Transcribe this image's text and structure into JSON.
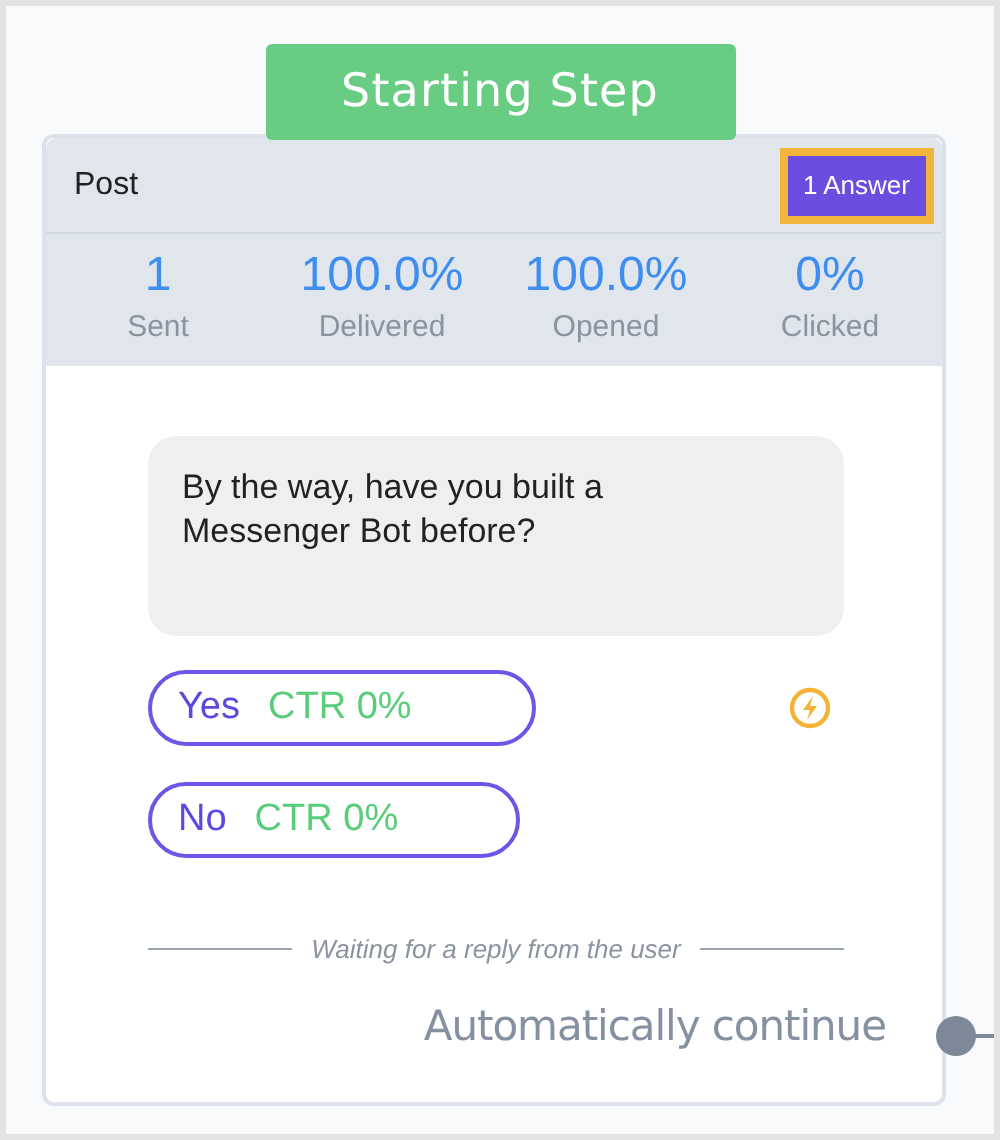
{
  "banner": {
    "title": "Starting Step"
  },
  "card": {
    "title": "Post",
    "answer_button": "1 Answer"
  },
  "stats": [
    {
      "value": "1",
      "label": "Sent"
    },
    {
      "value": "100.0%",
      "label": "Delivered"
    },
    {
      "value": "100.0%",
      "label": "Opened"
    },
    {
      "value": "0%",
      "label": "Clicked"
    }
  ],
  "message": "By the way, have you built a Messenger Bot before?",
  "replies": [
    {
      "label": "Yes",
      "ctr": "CTR 0%",
      "action": true
    },
    {
      "label": "No",
      "ctr": "CTR 0%",
      "action": false
    }
  ],
  "waiting": "Waiting for a reply from the user",
  "continue": "Automatically continue"
}
